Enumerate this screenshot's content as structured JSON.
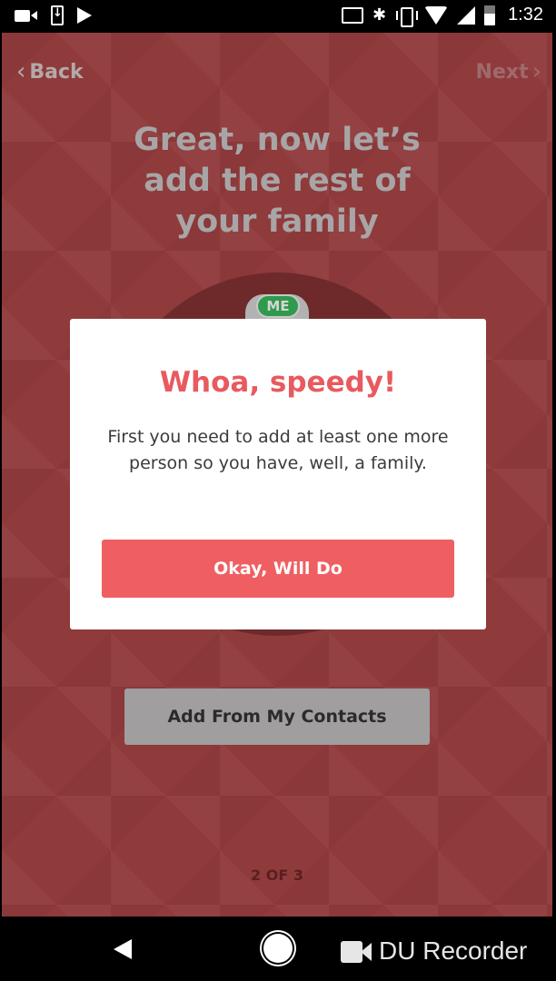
{
  "status_bar": {
    "left_icons": [
      "video-camera-icon",
      "download-icon",
      "play-store-icon"
    ],
    "right_icons": [
      "cast-icon",
      "bluetooth-icon",
      "vibrate-icon",
      "wifi-icon",
      "signal-icon",
      "battery-icon"
    ],
    "time": "1:32"
  },
  "header": {
    "back_label": "Back",
    "next_label": "Next",
    "back_icon": "chevron-left-icon",
    "next_icon": "chevron-right-icon"
  },
  "main": {
    "headline_lines": [
      "Great, now let’s",
      "add the rest of",
      "your family"
    ],
    "me_badge": "ME",
    "contacts_button": "Add From My Contacts",
    "step_indicator": "2 OF 3"
  },
  "dialog": {
    "title": "Whoa, speedy!",
    "body": "First you need to add at least one more person so you have, well, a family.",
    "button": "Okay, Will Do"
  },
  "nav_bar": {
    "icons": [
      "back-icon",
      "home-icon"
    ],
    "overlay_text": "DU Recorder"
  },
  "colors": {
    "background": "#8f3a3b",
    "accent": "#ef5f62",
    "dialog_title": "#e85a5f",
    "me_badge": "#2f9a4c"
  }
}
